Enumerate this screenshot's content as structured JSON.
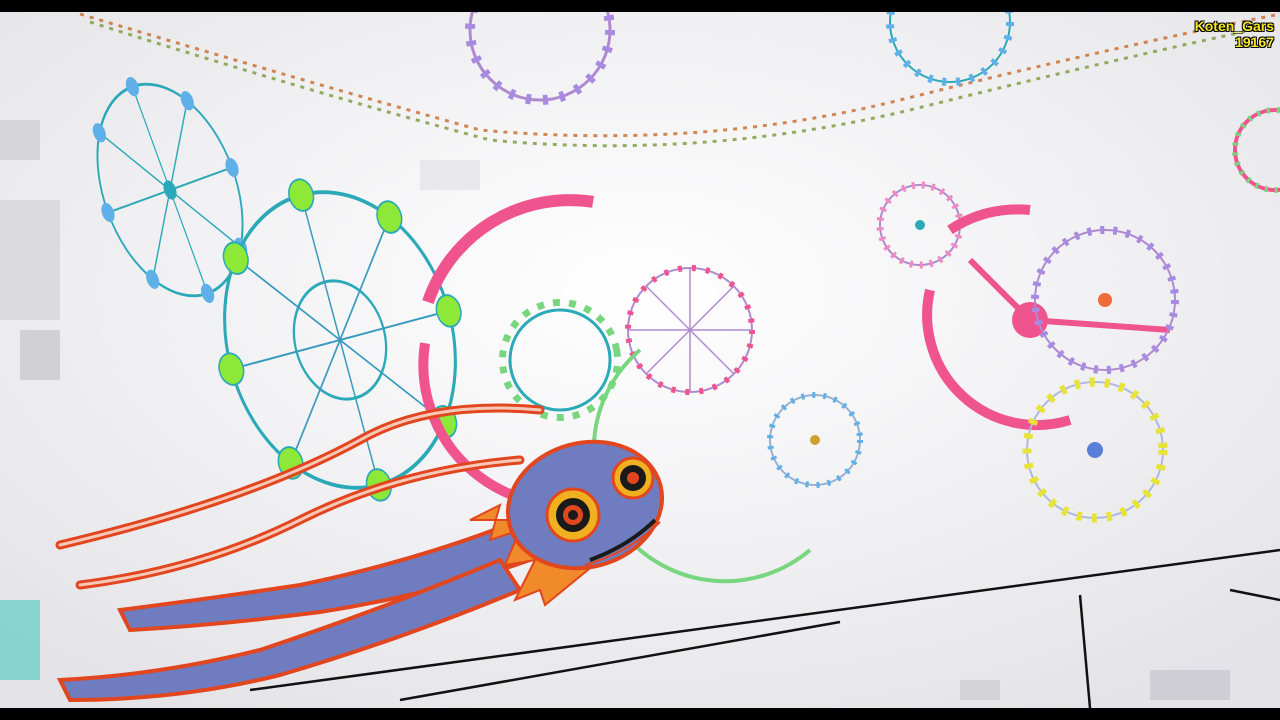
{
  "watermark": {
    "name": "Koten_Gars",
    "count": "19167"
  },
  "palette": {
    "background": "#f2f2f3",
    "letterbox": "#000000",
    "watermark_text": "#f5e626",
    "wheel_teal": "#2ba9b8",
    "wheel_pink": "#f0548f",
    "wheel_green": "#78d67f",
    "wheel_blue": "#5a7fd8",
    "gondola_lime": "#8ee838",
    "gondola_yellow": "#e8e337",
    "creature_body": "#6f7cc0",
    "creature_outline": "#e2461e"
  },
  "scene": {
    "subject": "creature-with-ferris-wheels"
  }
}
